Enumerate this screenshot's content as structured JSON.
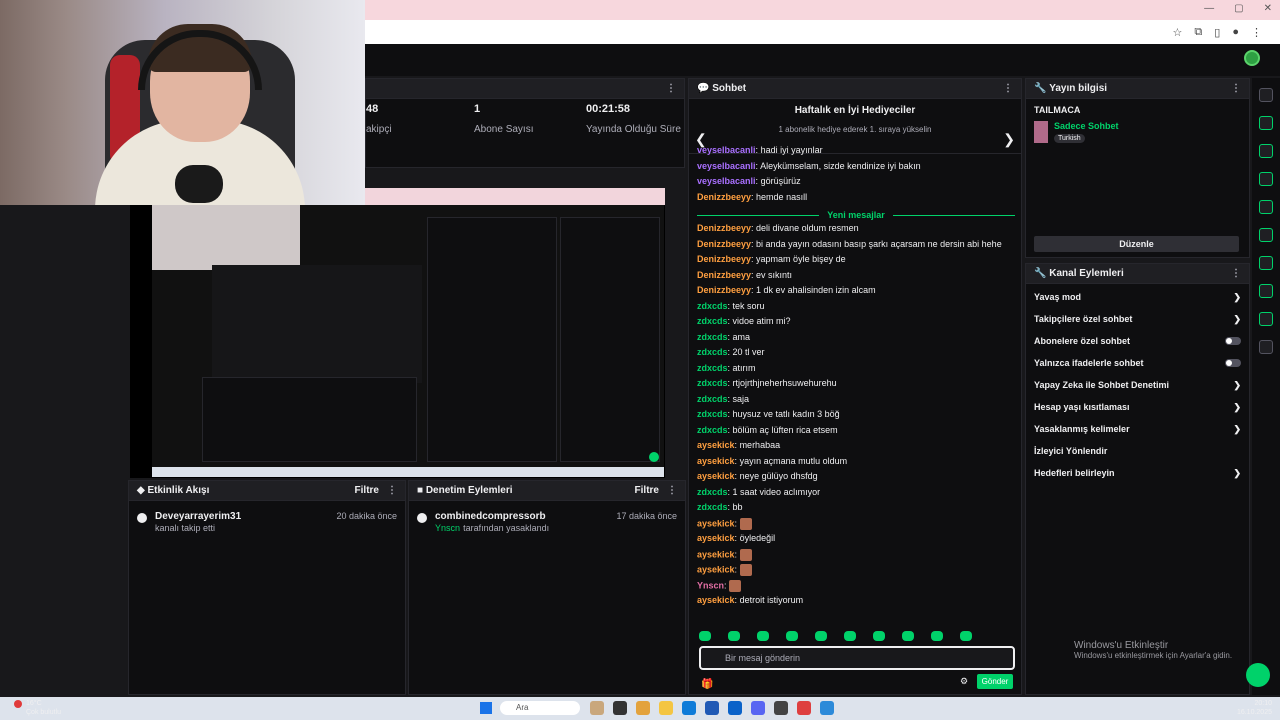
{
  "stats": [
    {
      "value": "48",
      "label": "akipçi"
    },
    {
      "value": "1",
      "label": "Abone Sayısı"
    },
    {
      "value": "00:21:58",
      "label": "Yayında Olduğu Süre"
    }
  ],
  "activity": {
    "title": "Etkinlik Akışı",
    "filter": "Filtre",
    "user": "Deveyarrayerim31",
    "action": "kanalı takip etti",
    "time": "20 dakika önce"
  },
  "audit": {
    "title": "Denetim Eylemleri",
    "filter": "Filtre",
    "user": "combinedcompressorb",
    "by": "Ynscn",
    "action": "tarafından yasaklandı",
    "time": "17 dakika önce"
  },
  "chat": {
    "title": "Sohbet",
    "gifts_title": "Haftalık en İyi Hediyeciler",
    "gifts_sub": "1 abonelik hediye ederek 1. sıraya yükselin",
    "new_messages": "Yeni mesajlar",
    "top": [
      {
        "user": "veyselbacanli",
        "text": "hadi iyi yayınlar"
      },
      {
        "user": "veyselbacanli",
        "text": "Aleykümselam, sizde kendinize iyi bakın"
      },
      {
        "user": "veyselbacanli",
        "text": "görüşürüz"
      },
      {
        "user": "Denizzbeeyy",
        "text": "hemde nasıll"
      }
    ],
    "messages": [
      {
        "user": "Denizzbeeyy",
        "text": "deli divane oldum resmen"
      },
      {
        "user": "Denizzbeeyy",
        "text": "bi anda yayın odasını basıp şarkı açarsam ne dersin abi hehe"
      },
      {
        "user": "Denizzbeeyy",
        "text": "yapmam öyle bişey de"
      },
      {
        "user": "Denizzbeeyy",
        "text": "ev sıkıntı"
      },
      {
        "user": "Denizzbeeyy",
        "text": "1 dk ev ahalisinden izin alcam"
      },
      {
        "user": "zdxcds",
        "text": "tek soru"
      },
      {
        "user": "zdxcds",
        "text": "vidoe atim mi?"
      },
      {
        "user": "zdxcds",
        "text": "ama"
      },
      {
        "user": "zdxcds",
        "text": "20 tl ver"
      },
      {
        "user": "zdxcds",
        "text": "atırım"
      },
      {
        "user": "zdxcds",
        "text": "rtjojrthjneherhsuwehurehu"
      },
      {
        "user": "zdxcds",
        "text": "saja"
      },
      {
        "user": "zdxcds",
        "text": "huysuz ve tatlı kadın 3 böğ"
      },
      {
        "user": "zdxcds",
        "text": "bölüm aç lüften rica etsem"
      },
      {
        "user": "aysekick",
        "text": "merhabaa"
      },
      {
        "user": "aysekick",
        "text": "yayın açmana mutlu oldum"
      },
      {
        "user": "aysekick",
        "text": "neye gülüyo dhsfdg"
      },
      {
        "user": "zdxcds",
        "text": "1 saat video aclımıyor"
      },
      {
        "user": "zdxcds",
        "text": "bb"
      },
      {
        "user": "aysekick",
        "text": ""
      },
      {
        "user": "aysekick",
        "text": "öyledeğil"
      },
      {
        "user": "aysekick",
        "text": ""
      },
      {
        "user": "aysekick",
        "text": ""
      },
      {
        "user": "Ynscn",
        "text": ""
      },
      {
        "user": "aysekick",
        "text": "detroit istiyorum"
      }
    ],
    "input_placeholder": "Bir mesaj gönderin",
    "send": "Gönder"
  },
  "info": {
    "title": "Yayın bilgisi",
    "category": "TAILMACA",
    "mode": "Sadece Sohbet",
    "lang": "Turkish",
    "edit": "Düzenle"
  },
  "channel_actions": {
    "title": "Kanal Eylemleri",
    "items": [
      "Yavaş mod",
      "Takipçilere özel sohbet",
      "Abonelere özel sohbet",
      "Yalnızca ifadelerle sohbet",
      "Yapay Zeka ile Sohbet Denetimi",
      "Hesap yaşı kısıtlaması",
      "Yasaklanmış kelimeler",
      "İzleyici Yönlendir",
      "Hedefleri belirleyin"
    ]
  },
  "watermark": {
    "title": "Windows'u Etkinleştir",
    "sub": "Windows'u etkinleştirmek için Ayarlar'a gidin."
  },
  "taskbar": {
    "search": "Ara",
    "weather": "16°C",
    "weather_sub": "Çok bulutlu",
    "time": "20:10",
    "date": "16.10.2025"
  },
  "colors": {
    "accent": "#00d26a",
    "bg": "#0e0e10"
  }
}
